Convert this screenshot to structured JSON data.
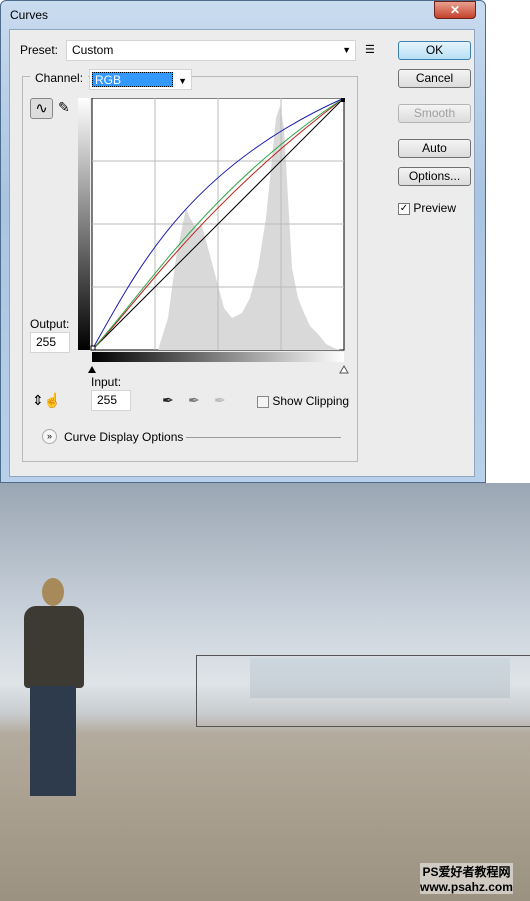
{
  "window": {
    "title": "Curves",
    "close_icon": "close-icon"
  },
  "preset": {
    "label": "Preset:",
    "value": "Custom"
  },
  "channel": {
    "label": "Channel:",
    "value": "RGB"
  },
  "buttons": {
    "ok": "OK",
    "cancel": "Cancel",
    "smooth": "Smooth",
    "auto": "Auto",
    "options": "Options..."
  },
  "preview": {
    "label": "Preview",
    "checked": true
  },
  "output": {
    "label": "Output:",
    "value": "255"
  },
  "input": {
    "label": "Input:",
    "value": "255"
  },
  "show_clipping": {
    "label": "Show Clipping",
    "checked": false
  },
  "curve_display_options": "Curve Display Options",
  "curve_colors": {
    "blue": "#1a1ab0",
    "green": "#2fa84a",
    "red": "#c0201a",
    "rgb": "#000000"
  },
  "watermark": {
    "line1": "PS爱好者教程网",
    "line2": "www.psahz.com"
  }
}
